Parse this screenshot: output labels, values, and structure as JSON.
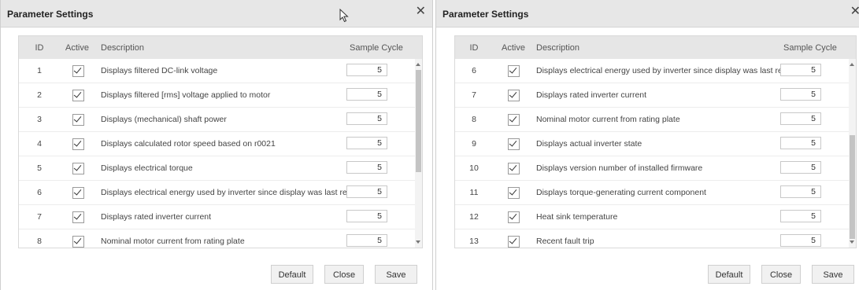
{
  "dialogs": [
    {
      "title": "Parameter Settings",
      "close_glyph": "✕",
      "columns": {
        "id": "ID",
        "active": "Active",
        "description": "Description",
        "sample_cycle": "Sample Cycle"
      },
      "rows": [
        {
          "id": "1",
          "active": true,
          "description": "Displays filtered DC-link voltage",
          "sample_cycle": "5"
        },
        {
          "id": "2",
          "active": true,
          "description": "Displays filtered [rms] voltage applied to motor",
          "sample_cycle": "5"
        },
        {
          "id": "3",
          "active": true,
          "description": "Displays (mechanical) shaft power",
          "sample_cycle": "5"
        },
        {
          "id": "4",
          "active": true,
          "description": "Displays calculated rotor speed based on r0021",
          "sample_cycle": "5"
        },
        {
          "id": "5",
          "active": true,
          "description": "Displays electrical torque",
          "sample_cycle": "5"
        },
        {
          "id": "6",
          "active": true,
          "description": "Displays electrical energy used by inverter since display was last reset",
          "sample_cycle": "5"
        },
        {
          "id": "7",
          "active": true,
          "description": "Displays rated inverter current",
          "sample_cycle": "5"
        },
        {
          "id": "8",
          "active": true,
          "description": "Nominal motor current from rating plate",
          "sample_cycle": "5"
        }
      ],
      "buttons": {
        "default": "Default",
        "close": "Close",
        "save": "Save"
      }
    },
    {
      "title": "Parameter Settings",
      "close_glyph": "✕",
      "columns": {
        "id": "ID",
        "active": "Active",
        "description": "Description",
        "sample_cycle": "Sample Cycle"
      },
      "rows": [
        {
          "id": "6",
          "active": true,
          "description": "Displays electrical energy used by inverter since display was last reset",
          "sample_cycle": "5"
        },
        {
          "id": "7",
          "active": true,
          "description": "Displays rated inverter current",
          "sample_cycle": "5"
        },
        {
          "id": "8",
          "active": true,
          "description": "Nominal motor current from rating plate",
          "sample_cycle": "5"
        },
        {
          "id": "9",
          "active": true,
          "description": "Displays actual inverter state",
          "sample_cycle": "5"
        },
        {
          "id": "10",
          "active": true,
          "description": "Displays version number of installed firmware",
          "sample_cycle": "5"
        },
        {
          "id": "11",
          "active": true,
          "description": "Displays torque-generating current component",
          "sample_cycle": "5"
        },
        {
          "id": "12",
          "active": true,
          "description": "Heat sink temperature",
          "sample_cycle": "5"
        },
        {
          "id": "13",
          "active": true,
          "description": "Recent fault trip",
          "sample_cycle": "5"
        }
      ],
      "buttons": {
        "default": "Default",
        "close": "Close",
        "save": "Save"
      }
    }
  ],
  "icons": {
    "close": "close-icon",
    "check": "checkmark-icon",
    "cursor": "mouse-pointer-icon"
  }
}
